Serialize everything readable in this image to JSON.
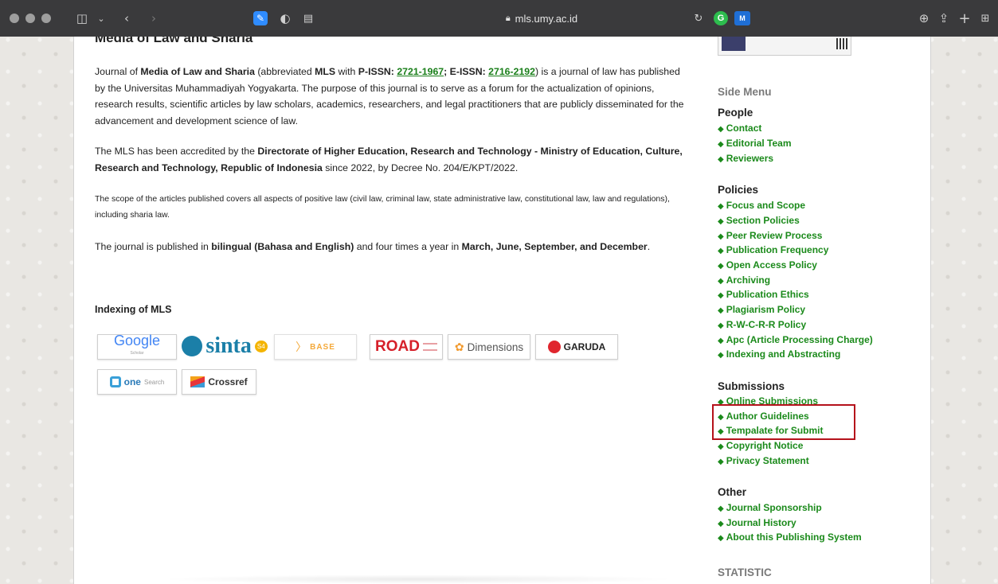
{
  "browser": {
    "url": "mls.umy.ac.id"
  },
  "main": {
    "clipped_title": "Media of Law and Sharia",
    "p1": {
      "t1": "Journal of ",
      "b1": "Media of Law and Sharia",
      "t2": " (abbreviated ",
      "b2": "MLS",
      "t3": " with ",
      "b3": "P-ISSN: ",
      "link1": "2721-1967",
      "t4": "; ",
      "b4": "E-ISSN: ",
      "link2": "2716-2192",
      "t5": ") is a journal of law has published by the Universitas Muhammadiyah Yogyakarta. The purpose of this journal is to serve as a forum for the actualization of opinions, research results, scientific articles by law scholars, academics, researchers, and legal practitioners that are publicly disseminated for the advancement and development science of law."
    },
    "p2": {
      "t1": "The MLS has been accredited by the ",
      "b1": "Directorate of Higher Education, Research and Technology - Ministry of Education, Culture, Research and Technology, Republic of Indonesia",
      "t2": " since 2022, by Decree No. 204/E/KPT/2022."
    },
    "p3": "The scope of the articles published covers all aspects of positive law (civil law, criminal law, state administrative law, constitutional law, law and regulations), including sharia law.",
    "p4": {
      "t1": "The journal is published in ",
      "b1": "bilingual (Bahasa and English)",
      "t2": " and four times a year in ",
      "b2": "March, June, September, and December",
      "t3": "."
    },
    "indexing_heading": "Indexing of MLS",
    "logos": {
      "google": "Google",
      "google_sub": "Scholar",
      "sinta": "sinta",
      "sinta_badge": "S4",
      "base": "BASE",
      "road": "ROAD",
      "dimensions": "Dimensions",
      "garuda": "GARUDA",
      "onesearch": "one",
      "onesearch_suffix": "Search",
      "crossref": "Crossref"
    }
  },
  "sidebar": {
    "side_menu_title": "Side Menu",
    "people": {
      "title": "People",
      "items": [
        "Contact",
        "Editorial Team",
        "Reviewers"
      ]
    },
    "policies": {
      "title": "Policies",
      "items": [
        "Focus and Scope",
        "Section Policies",
        "Peer Review Process",
        "Publication Frequency",
        "Open Access Policy",
        "Archiving",
        "Publication Ethics",
        "Plagiarism Policy",
        "R-W-C-R-R Policy",
        "Apc (Article Processing Charge)",
        "Indexing and Abstracting"
      ]
    },
    "submissions": {
      "title": "Submissions",
      "items": [
        "Online Submissions",
        "Author Guidelines",
        "Tempalate for Submit",
        "Copyright Notice",
        "Privacy Statement"
      ]
    },
    "other": {
      "title": "Other",
      "items": [
        "Journal Sponsorship",
        "Journal History",
        "About this Publishing System"
      ]
    },
    "statistic_title": "STATISTIC"
  },
  "colors": {
    "link_green": "#1b8a1b",
    "highlight_red": "#b5121b",
    "toolbar": "#3a3a3c"
  }
}
